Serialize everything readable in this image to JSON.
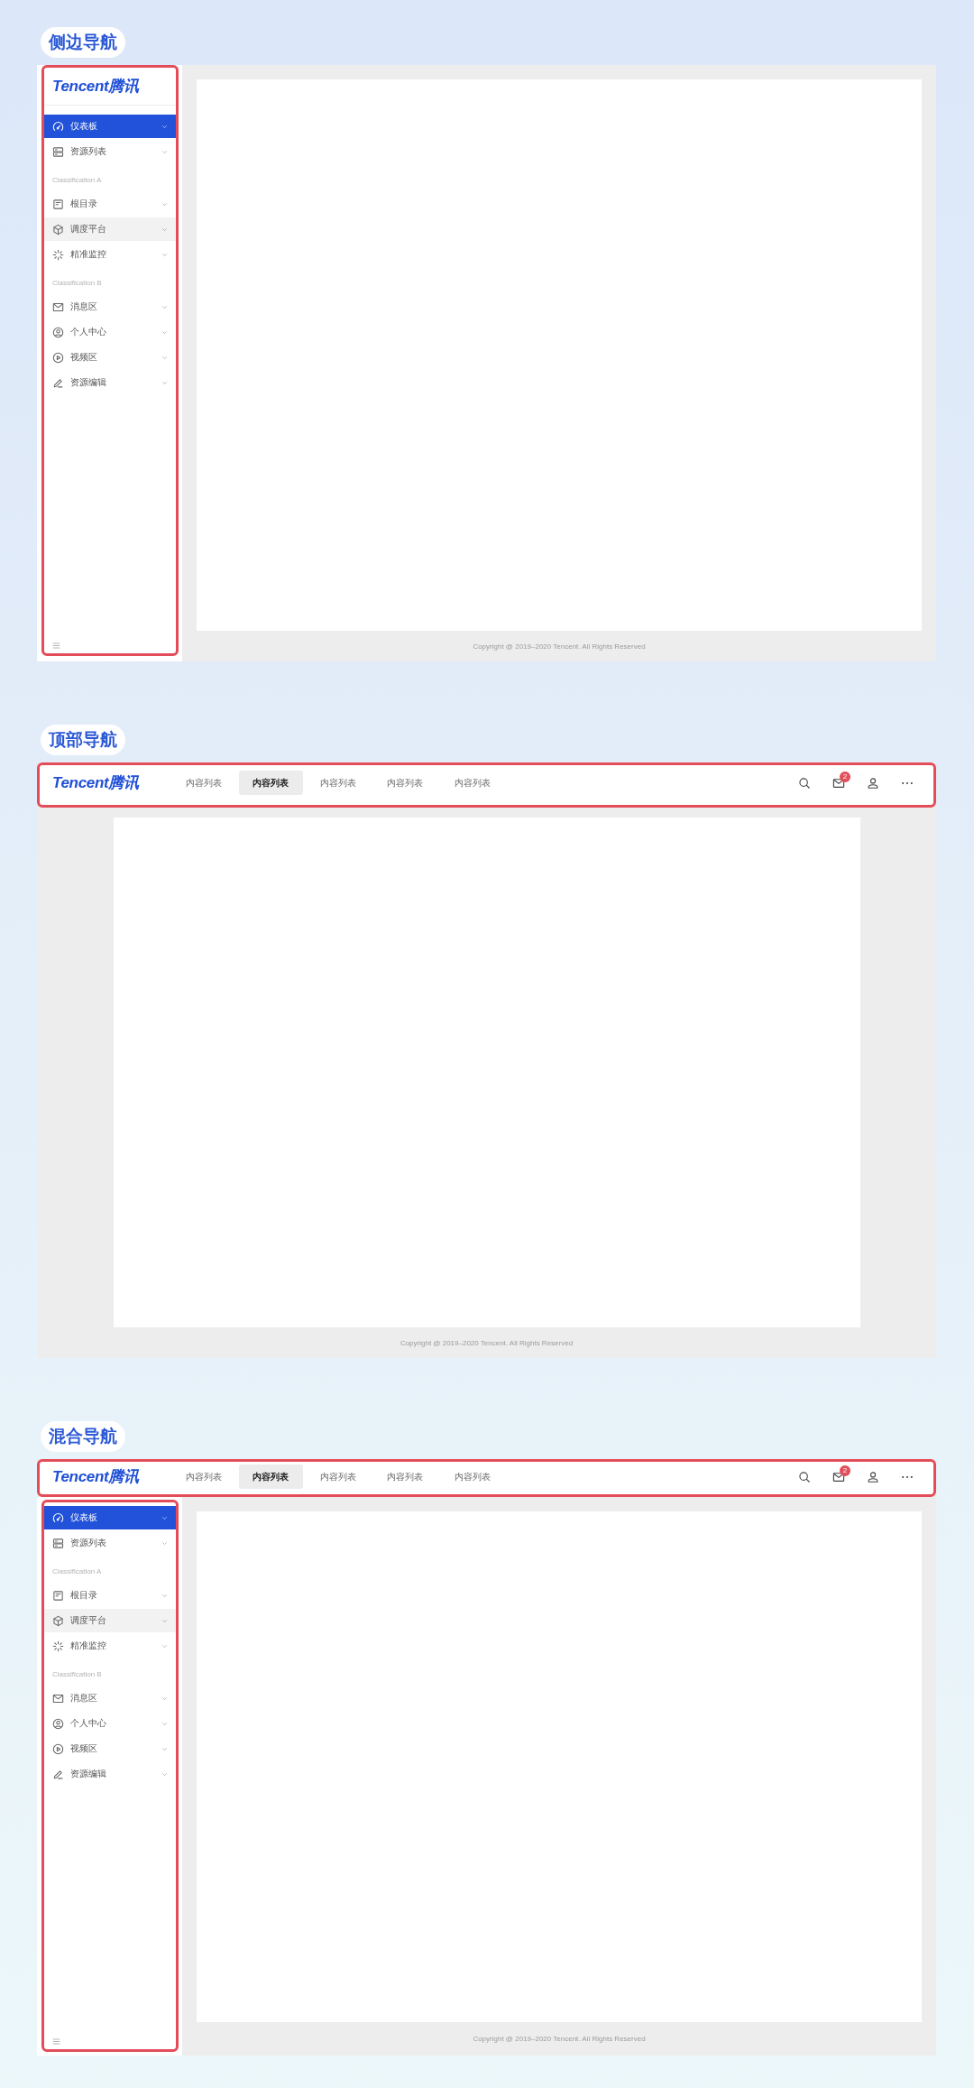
{
  "sections": [
    {
      "kind": "side",
      "title": "侧边导航",
      "sidebar": {
        "logo": "Tencent腾讯",
        "menu": [
          {
            "kind": "item",
            "label": "仪表板",
            "selected": true,
            "hovered": false
          },
          {
            "kind": "item",
            "label": "资源列表",
            "selected": false,
            "hovered": false
          },
          {
            "kind": "group",
            "label": "Classification A"
          },
          {
            "kind": "item",
            "label": "根目录",
            "selected": false,
            "hovered": false
          },
          {
            "kind": "item",
            "label": "调度平台",
            "selected": false,
            "hovered": true
          },
          {
            "kind": "item",
            "label": "精准监控",
            "selected": false,
            "hovered": false
          },
          {
            "kind": "group",
            "label": "Classification B"
          },
          {
            "kind": "item",
            "label": "消息区",
            "selected": false,
            "hovered": false
          },
          {
            "kind": "item",
            "label": "个人中心",
            "selected": false,
            "hovered": false
          },
          {
            "kind": "item",
            "label": "视频区",
            "selected": false,
            "hovered": false
          },
          {
            "kind": "item",
            "label": "资源编辑",
            "selected": false,
            "hovered": false
          }
        ]
      },
      "footer": "Copyright @ 2019–2020 Tencent. All Rights Reserved"
    },
    {
      "kind": "top",
      "title": "顶部导航",
      "header": {
        "logo": "Tencent腾讯",
        "tabs": [
          {
            "label": "内容列表",
            "selected": false
          },
          {
            "label": "内容列表",
            "selected": true
          },
          {
            "label": "内容列表",
            "selected": false
          },
          {
            "label": "内容列表",
            "selected": false
          },
          {
            "label": "内容列表",
            "selected": false
          }
        ],
        "mail_badge": "2"
      },
      "footer": "Copyright @ 2019–2020 Tencent. All Rights Reserved"
    },
    {
      "kind": "mixed",
      "title": "混合导航",
      "header": {
        "logo": "Tencent腾讯",
        "tabs": [
          {
            "label": "内容列表",
            "selected": false
          },
          {
            "label": "内容列表",
            "selected": true
          },
          {
            "label": "内容列表",
            "selected": false
          },
          {
            "label": "内容列表",
            "selected": false
          },
          {
            "label": "内容列表",
            "selected": false
          }
        ],
        "mail_badge": "2"
      },
      "sidebar": {
        "menu": [
          {
            "kind": "item",
            "label": "仪表板",
            "selected": true,
            "hovered": false
          },
          {
            "kind": "item",
            "label": "资源列表",
            "selected": false,
            "hovered": false
          },
          {
            "kind": "group",
            "label": "Classification A"
          },
          {
            "kind": "item",
            "label": "根目录",
            "selected": false,
            "hovered": false
          },
          {
            "kind": "item",
            "label": "调度平台",
            "selected": false,
            "hovered": true
          },
          {
            "kind": "item",
            "label": "精准监控",
            "selected": false,
            "hovered": false
          },
          {
            "kind": "group",
            "label": "Classification B"
          },
          {
            "kind": "item",
            "label": "消息区",
            "selected": false,
            "hovered": false
          },
          {
            "kind": "item",
            "label": "个人中心",
            "selected": false,
            "hovered": false
          },
          {
            "kind": "item",
            "label": "视频区",
            "selected": false,
            "hovered": false
          },
          {
            "kind": "item",
            "label": "资源编辑",
            "selected": false,
            "hovered": false
          }
        ]
      },
      "footer": "Copyright @ 2019–2020 Tencent. All Rights Reserved"
    }
  ]
}
